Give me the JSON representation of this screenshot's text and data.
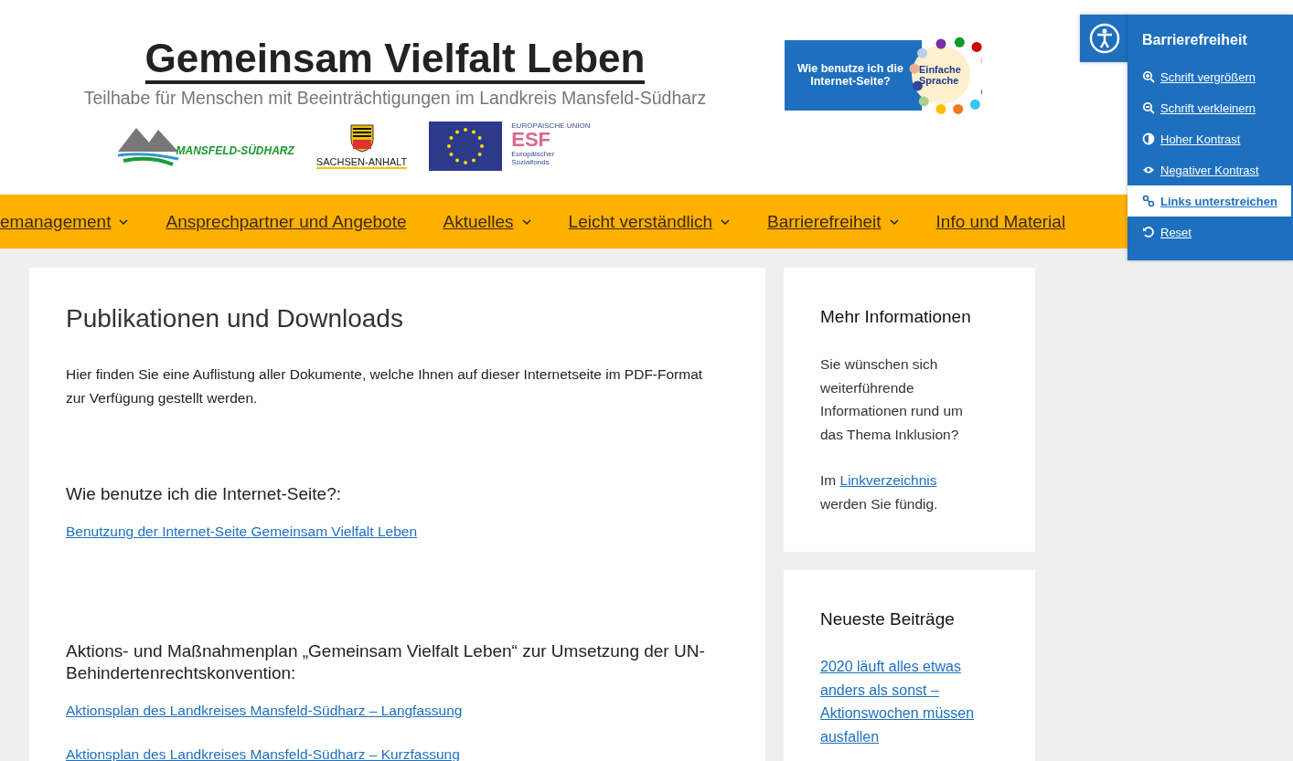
{
  "header": {
    "title": "Gemeinsam Vielfalt Leben",
    "subtitle": "Teilhabe für Menschen mit Beeinträchtigungen im Landkreis Mansfeld-Südharz",
    "logos": {
      "district": "MANSFELD-SÜDHARZ",
      "state": "SACHSEN-ANHALT",
      "eu_top": "EUROPÄISCHE UNION",
      "esf": "ESF",
      "esf_sub": "Europäischer Sozialfonds"
    },
    "easy_language": {
      "question": "Wie benutze ich die Internet-Seite?",
      "badge": "Einfache Sprache"
    }
  },
  "nav": [
    {
      "label": "emanagement",
      "dropdown": true
    },
    {
      "label": "Ansprechpartner und Angebote",
      "dropdown": false
    },
    {
      "label": "Aktuelles",
      "dropdown": true
    },
    {
      "label": "Leicht verständlich",
      "dropdown": true
    },
    {
      "label": "Barrierefreiheit",
      "dropdown": true
    },
    {
      "label": "Info und Material",
      "dropdown": false
    }
  ],
  "main": {
    "title": "Publikationen und Downloads",
    "intro": "Hier finden Sie eine Auflistung aller Dokumente, welche Ihnen auf dieser Internetseite im PDF-Format zur Verfügung gestellt werden.",
    "sections": [
      {
        "heading": "Wie benutze ich die Internet-Seite?:",
        "links": [
          "Benutzung der Internet-Seite Gemeinsam Vielfalt Leben"
        ]
      },
      {
        "heading": "Aktions- und Maßnahmenplan „Gemeinsam Vielfalt Leben“ zur Umsetzung der UN-Behindertenrechtskonvention:",
        "links": [
          "Aktionsplan des Landkreises Mansfeld-Südharz – Langfassung",
          "Aktionsplan des Landkreises Mansfeld-Südharz – Kurzfassung"
        ]
      }
    ]
  },
  "sidebar": [
    {
      "kind": "info",
      "title": "Mehr Informationen",
      "text": "Sie wünschen sich weiterführende Informationen rund um das Thema Inklusion?",
      "pre": "Im",
      "link": "Linkverzeichnis",
      "post": "werden Sie fündig."
    },
    {
      "kind": "posts",
      "title": "Neueste Beiträge",
      "posts": [
        "2020 läuft alles etwas anders als sonst – Aktionswochen müssen ausfallen"
      ]
    }
  ],
  "accessibility": {
    "title": "Barrierefreiheit",
    "items": [
      {
        "kind": "zoom-in",
        "label": "Schrift vergrößern",
        "selected": false
      },
      {
        "kind": "zoom-out",
        "label": "Schrift verkleinern",
        "selected": false
      },
      {
        "kind": "contrast",
        "label": "Hoher Kontrast",
        "selected": false
      },
      {
        "kind": "eye",
        "label": "Negativer Kontrast",
        "selected": false
      },
      {
        "kind": "link",
        "label": "Links unterstreichen",
        "selected": true
      },
      {
        "kind": "reset",
        "label": " Reset",
        "selected": false
      }
    ]
  }
}
